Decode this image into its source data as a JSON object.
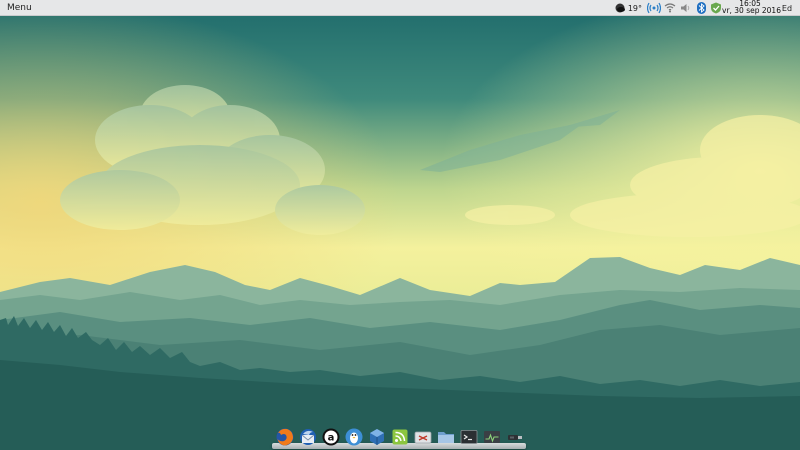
{
  "panel": {
    "menu_label": "Menu",
    "weather_temp": "19°",
    "clock_time": "16:05",
    "clock_date": "vr, 30 sep 2016",
    "user_label": "Ed",
    "tray_icons": [
      "weather-icon",
      "broadcast-icon",
      "wifi-icon",
      "volume-icon",
      "bluetooth-icon",
      "shield-check-icon"
    ]
  },
  "dock": {
    "apps": [
      "firefox-icon",
      "thunderbird-icon",
      "amazon-icon",
      "tux-icon",
      "virtualbox-icon",
      "rss-reader-icon",
      "settings-tools-icon",
      "files-icon",
      "terminal-icon",
      "system-monitor-icon",
      "usb-drive-icon"
    ]
  },
  "colors": {
    "sky_top": "#1f6f6c",
    "sky_glow": "#f3ef9a",
    "panel_bg": "#e6e7e8"
  }
}
